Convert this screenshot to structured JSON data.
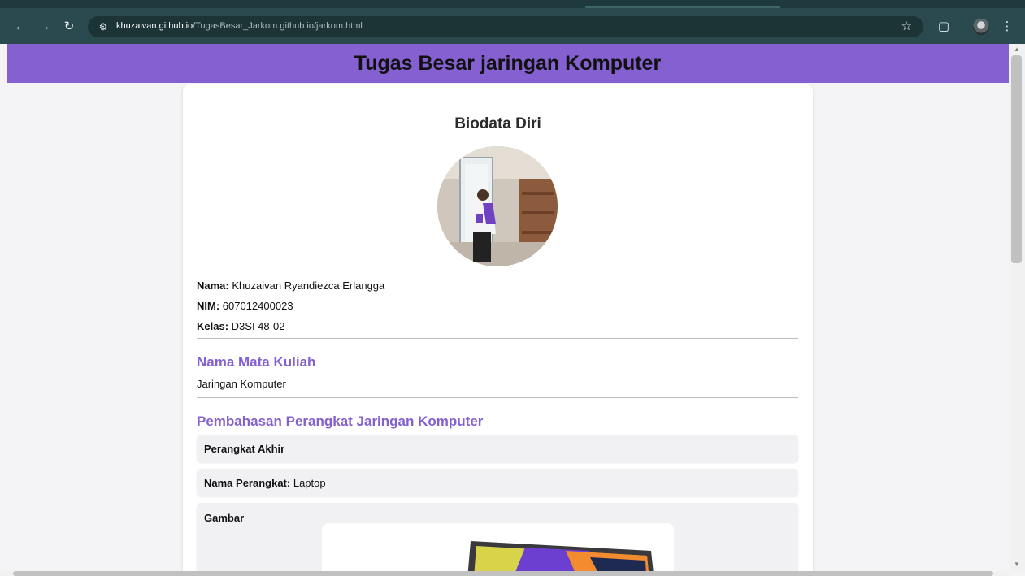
{
  "browser": {
    "url_host": "khuzaivan.github.io",
    "url_path": "/TugasBesar_Jarkom.github.io/jarkom.html",
    "icons": [
      "back-arrow-icon",
      "forward-arrow-icon",
      "reload-icon",
      "site-settings-icon",
      "bookmark-star-icon",
      "extensions-puzzle-icon",
      "profile-avatar-icon",
      "more-menu-icon"
    ]
  },
  "header": {
    "title": "Tugas Besar jaringan Komputer"
  },
  "biodata": {
    "title": "Biodata Diri",
    "nama_label": "Nama:",
    "nama_value": "Khuzaivan Ryandiezca Erlangga",
    "nim_label": "NIM:",
    "nim_value": "607012400023",
    "kelas_label": "Kelas:",
    "kelas_value": "D3SI 48-02"
  },
  "course": {
    "title": "Nama Mata Kuliah",
    "value": "Jaringan Komputer"
  },
  "devices": {
    "title": "Pembahasan Perangkat Jaringan Komputer",
    "category": "Perangkat Akhir",
    "name_label": "Nama Perangkat:",
    "name_value": "Laptop",
    "image_label": "Gambar"
  },
  "colors": {
    "header_bg": "#8460d0",
    "accent": "#8460d0",
    "chrome_bg": "#2b4a4f"
  }
}
